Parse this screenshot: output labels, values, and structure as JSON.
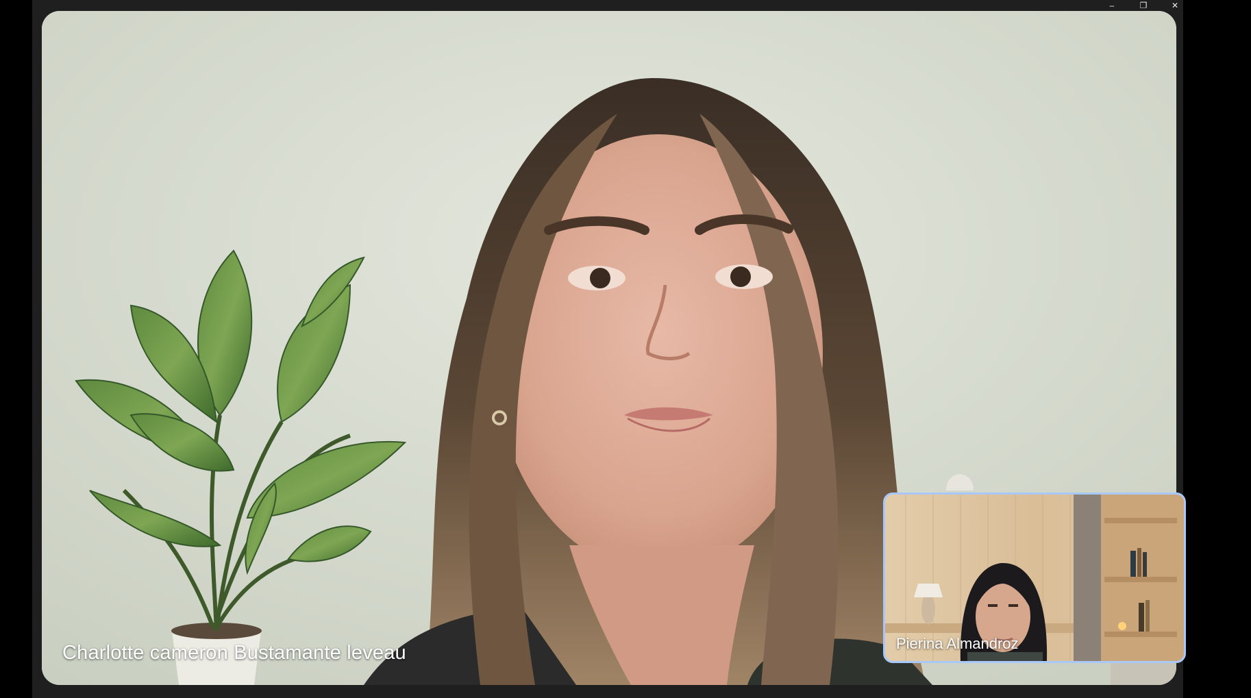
{
  "window_controls": {
    "minimize_glyph": "–",
    "restore_glyph": "❐",
    "close_glyph": "✕"
  },
  "main_participant": {
    "name": "Charlotte cameron Bustamante leveau"
  },
  "self_view": {
    "name": "Pierina Almandroz",
    "border_color": "#a8c7fa"
  }
}
